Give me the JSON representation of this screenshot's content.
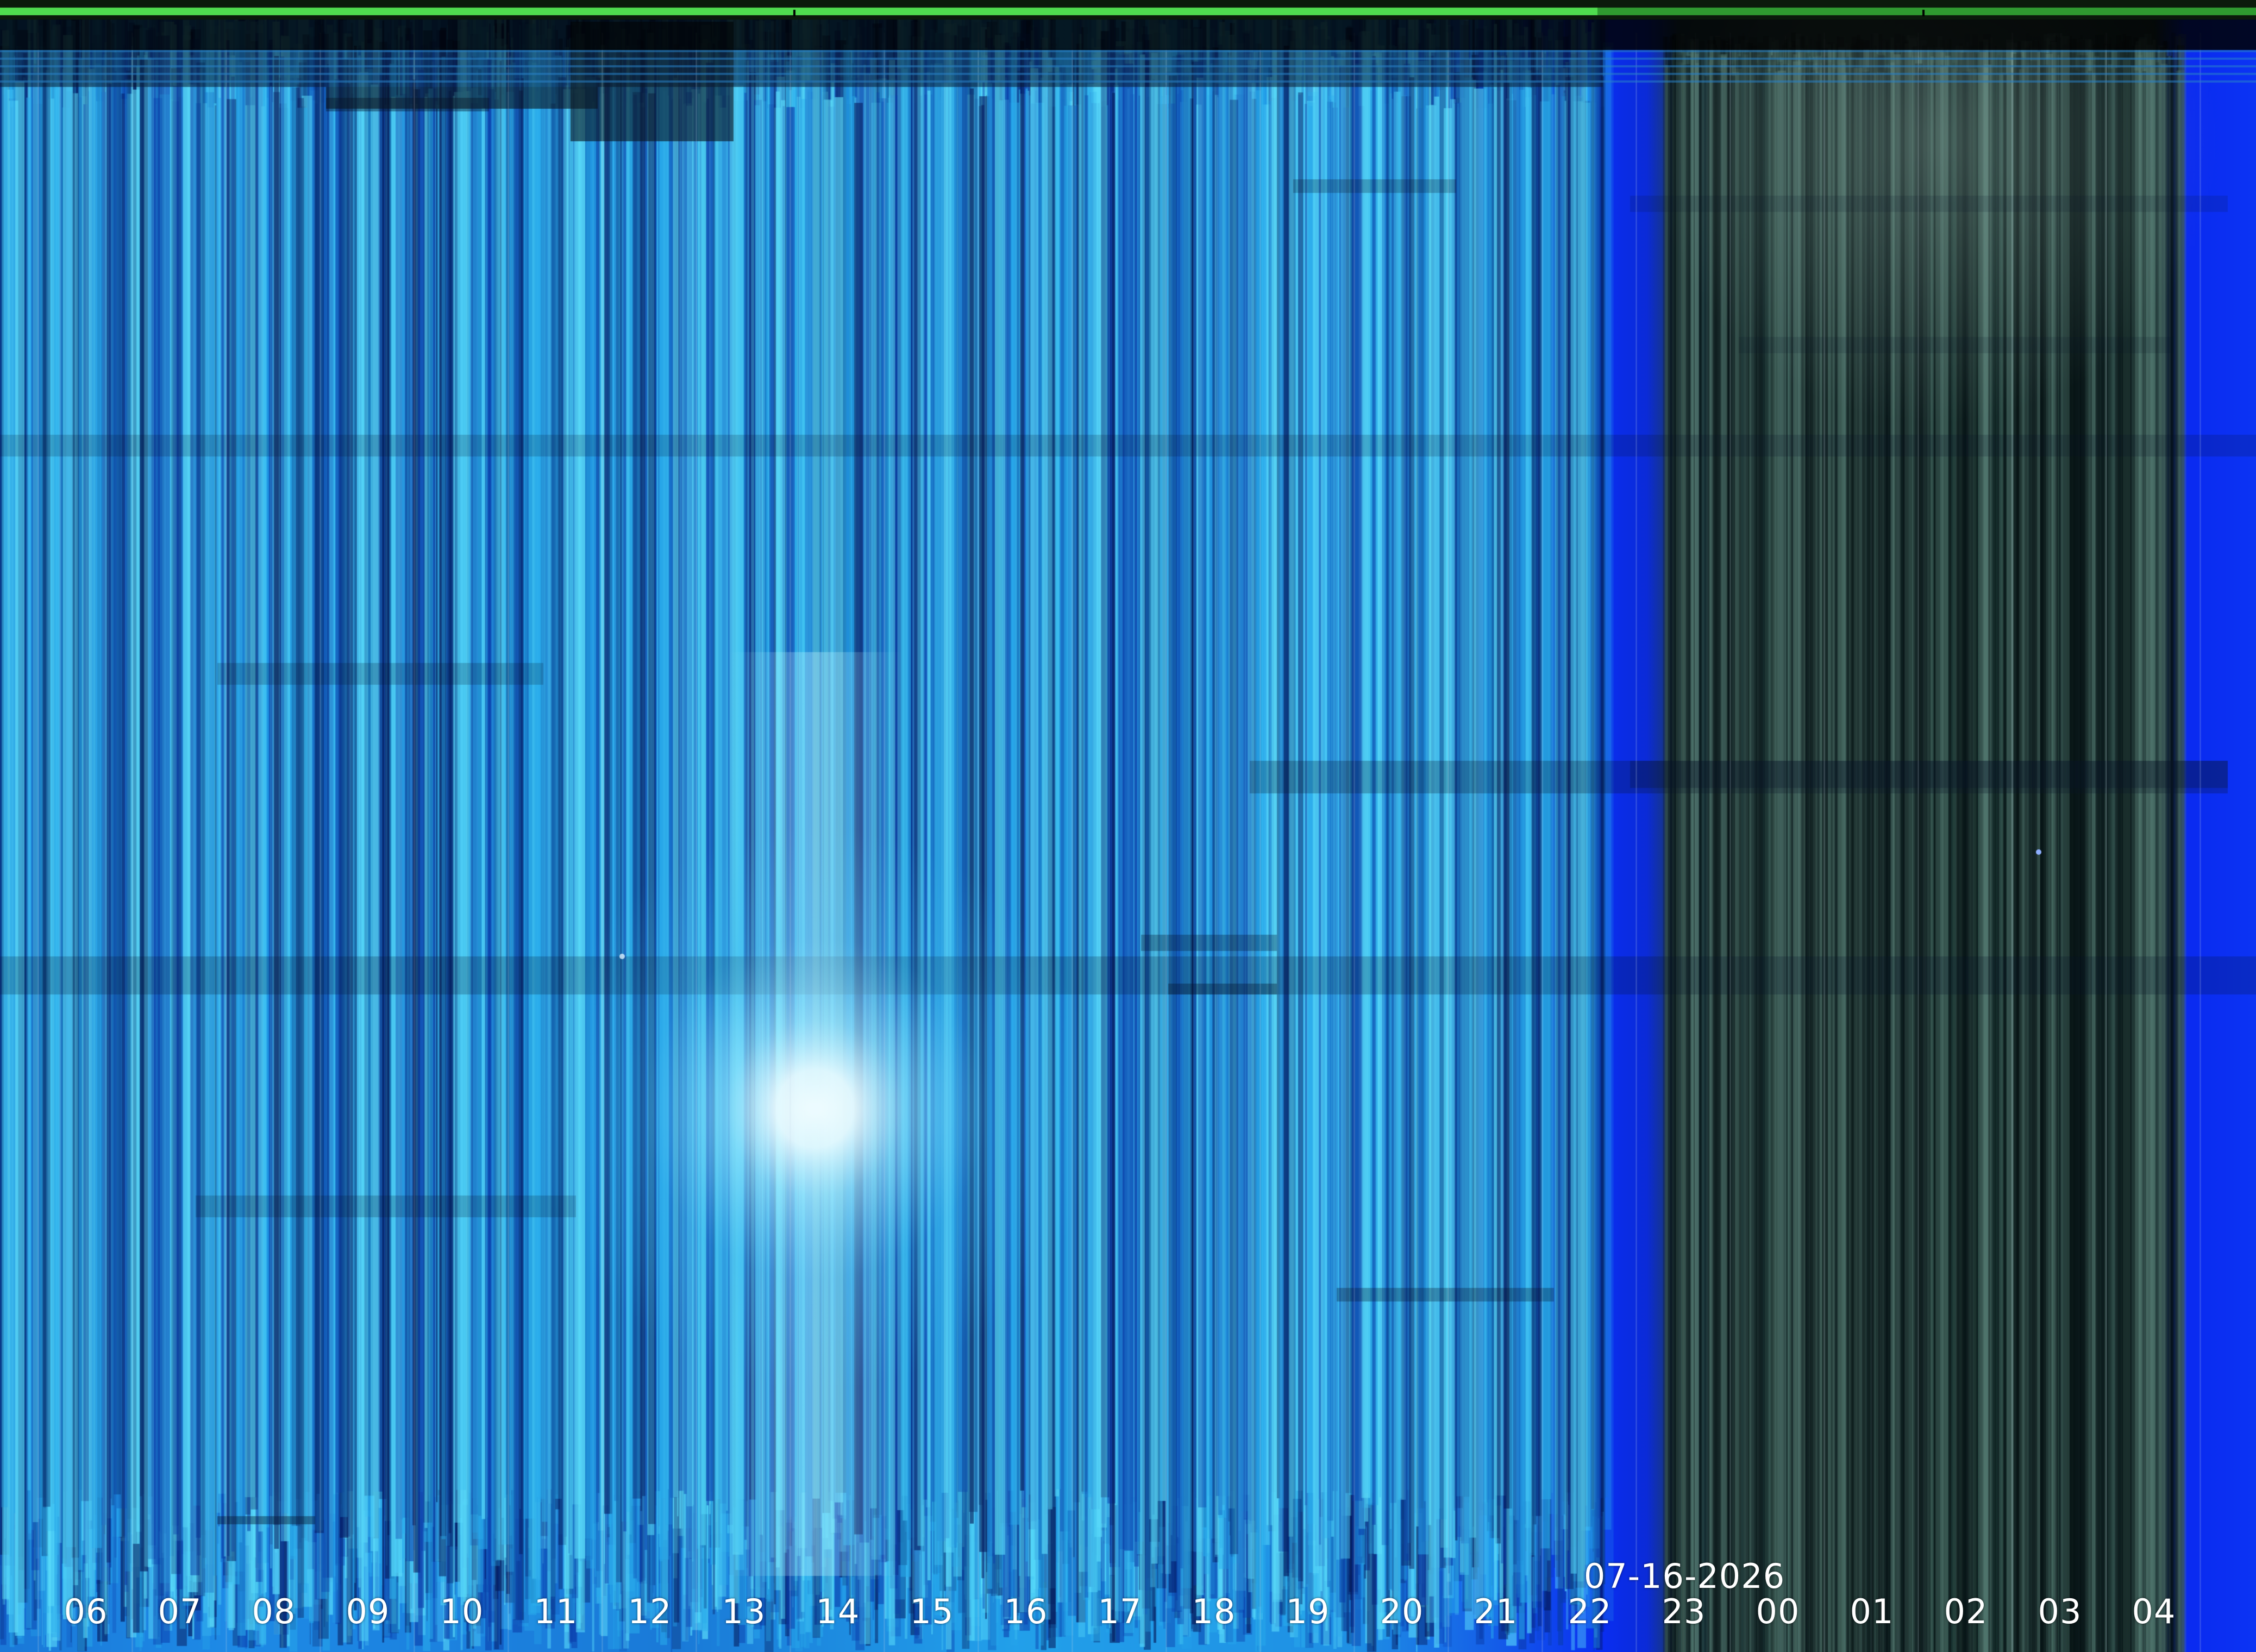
{
  "keogram": {
    "date": "07-16-2026",
    "hours": [
      "06",
      "07",
      "08",
      "09",
      "10",
      "11",
      "12",
      "13",
      "14",
      "15",
      "16",
      "17",
      "18",
      "19",
      "20",
      "21",
      "22",
      "23",
      "00",
      "01",
      "02",
      "03",
      "04"
    ],
    "colors": {
      "day_blue": "#1e8fe0",
      "day_cyan": "#38c8f0",
      "twilight_blue": "#0a2cf0",
      "night_teal": "#1f3d3a",
      "top_bar_green": "#4fdc4f",
      "label_white": "#ffffff"
    }
  }
}
